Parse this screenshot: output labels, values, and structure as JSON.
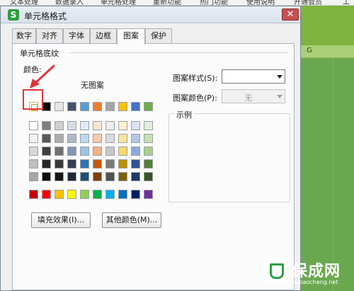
{
  "app": {
    "menus": [
      "文本处理",
      "数据录入",
      "单元格处理",
      "重新功能",
      "热门功能",
      "使用说明",
      "开通会员",
      "工"
    ],
    "column_header": "G"
  },
  "dialog": {
    "title": "单元格格式",
    "close_label": "✕",
    "tabs": [
      "数字",
      "对齐",
      "字体",
      "边框",
      "图案",
      "保护"
    ],
    "active_tab": "图案",
    "group_title": "单元格底纹",
    "color_label": "颜色:",
    "no_pattern_label": "无图案",
    "pattern_style_label": "图案样式(S):",
    "pattern_style_value": "",
    "pattern_color_label": "图案颜色(P):",
    "pattern_color_value": "无",
    "example_label": "示例",
    "fill_effects_button": "填充效果(I)...",
    "more_colors_button": "其他颜色(M)..."
  },
  "palette": {
    "rows": [
      [
        "none",
        "#000000",
        "#e7e6e6",
        "#44546a",
        "#5b9bd5",
        "#ed7d31",
        "#a5a5a5",
        "#ffc000",
        "#4472c4",
        "#70ad47"
      ],
      [
        "#ffffff",
        "#7f7f7f",
        "#d0cece",
        "#d6dce4",
        "#deebf6",
        "#fbe5d5",
        "#ededed",
        "#fff2cc",
        "#d9e2f3",
        "#e2efd9"
      ],
      [
        "#f2f2f2",
        "#595959",
        "#aeabab",
        "#adb9ca",
        "#bdd7ee",
        "#f7cbac",
        "#dbdbdb",
        "#fee599",
        "#b4c6e7",
        "#c5e0b3"
      ],
      [
        "#d8d8d8",
        "#3f3f3f",
        "#757070",
        "#8496b0",
        "#9dc3e6",
        "#f4b183",
        "#c9c9c9",
        "#ffd966",
        "#8eaadb",
        "#a8d08d"
      ],
      [
        "#bfbfbf",
        "#262626",
        "#3a3838",
        "#323f4f",
        "#2e75b5",
        "#c55a11",
        "#7b7b7b",
        "#bf9000",
        "#2f5496",
        "#538135"
      ],
      [
        "#a5a5a5",
        "#0c0c0c",
        "#171616",
        "#222a35",
        "#1e4e79",
        "#833c0b",
        "#525252",
        "#7f6000",
        "#1f3864",
        "#375623"
      ]
    ],
    "standard": [
      "#c00000",
      "#ff0000",
      "#ffc000",
      "#ffff00",
      "#92d050",
      "#00b050",
      "#00b0f0",
      "#0070c0",
      "#002060",
      "#7030a0"
    ]
  },
  "annotation": {
    "highlight_color": "#e0363a"
  },
  "watermark": {
    "title": "保成网",
    "url": "zsbaocheng.net"
  }
}
